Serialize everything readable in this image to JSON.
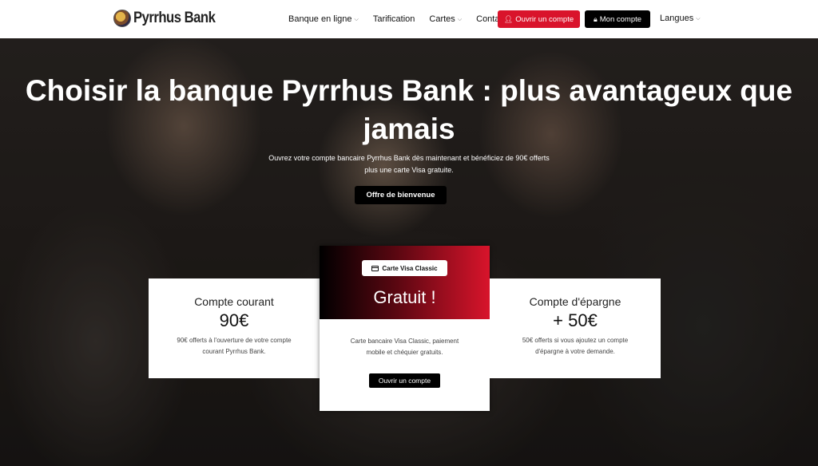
{
  "brand": {
    "name": "Pyrrhus Bank"
  },
  "nav": {
    "items": [
      {
        "label": "Banque en ligne",
        "dropdown": true
      },
      {
        "label": "Tarification",
        "dropdown": false
      },
      {
        "label": "Cartes",
        "dropdown": true
      },
      {
        "label": "Contact",
        "dropdown": false
      }
    ],
    "open_account": "Ouvrir un compte",
    "my_account": "Mon compte",
    "languages": "Langues"
  },
  "hero": {
    "title": "Choisir la banque Pyrrhus Bank : plus avantageux que jamais",
    "subtitle": "Ouvrez votre compte bancaire Pyrrhus Bank dès maintenant et bénéficiez de 90€ offerts plus une carte Visa gratuite.",
    "cta": "Offre de bienvenue"
  },
  "cards": {
    "left": {
      "title": "Compte courant",
      "value": "90€",
      "desc": "90€ offerts à l'ouverture de votre compte courant Pyrrhus Bank."
    },
    "center": {
      "badge": "Carte Visa Classic",
      "title": "Gratuit !",
      "desc": "Carte bancaire Visa Classic, paiement mobile et chéquier gratuits.",
      "cta": "Ouvrir un compte"
    },
    "right": {
      "title": "Compte d'épargne",
      "value": "+ 50€",
      "desc": "50€ offerts si vous ajoutez un compte d'épargne à votre demande."
    }
  },
  "colors": {
    "accent_red": "#d9132b",
    "black": "#000000"
  }
}
